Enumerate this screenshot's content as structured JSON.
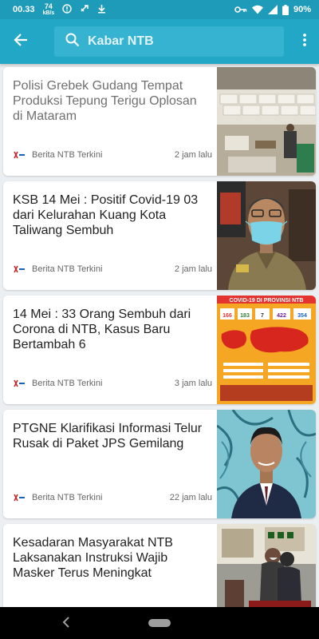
{
  "status_bar": {
    "time": "00.33",
    "net_speed_value": "74",
    "net_speed_unit": "kB/s",
    "battery": "90%",
    "icons": [
      "vpn-icon",
      "sync-icon",
      "download-icon",
      "key-icon",
      "wifi-icon",
      "signal-icon",
      "battery-icon"
    ]
  },
  "app_bar": {
    "search_query": "Kabar NTB",
    "colors": {
      "primary": "#22a7c6",
      "status": "#1e9bb8"
    }
  },
  "articles": [
    {
      "title": "Polisi Grebek Gudang Tempat Produksi Tepung Terigu Oplosan di Mataram",
      "source": "Berita NTB Terkini",
      "time": "2 jam lalu",
      "read": true
    },
    {
      "title": "KSB 14 Mei : Positif Covid-19 03 dari Kelurahan Kuang Kota Taliwang Sembuh",
      "source": "Berita NTB Terkini",
      "time": "2 jam lalu",
      "read": false
    },
    {
      "title": "14 Mei : 33 Orang Sembuh dari Corona di NTB, Kasus Baru Bertambah 6",
      "source": "Berita NTB Terkini",
      "time": "3 jam lalu",
      "read": false
    },
    {
      "title": "PTGNE Klarifikasi Informasi Telur Rusak di Paket JPS Gemilang",
      "source": "Berita NTB Terkini",
      "time": "22 jam lalu",
      "read": false
    },
    {
      "title": "Kesadaran Masyarakat NTB Laksanakan Instruksi Wajib Masker Terus Meningkat",
      "source": "",
      "time": "",
      "read": false
    }
  ],
  "infographic": {
    "header": "COVID-19 DI PROVINSI NTB",
    "numbers": [
      "166",
      "183",
      "7",
      "422",
      "354"
    ]
  }
}
